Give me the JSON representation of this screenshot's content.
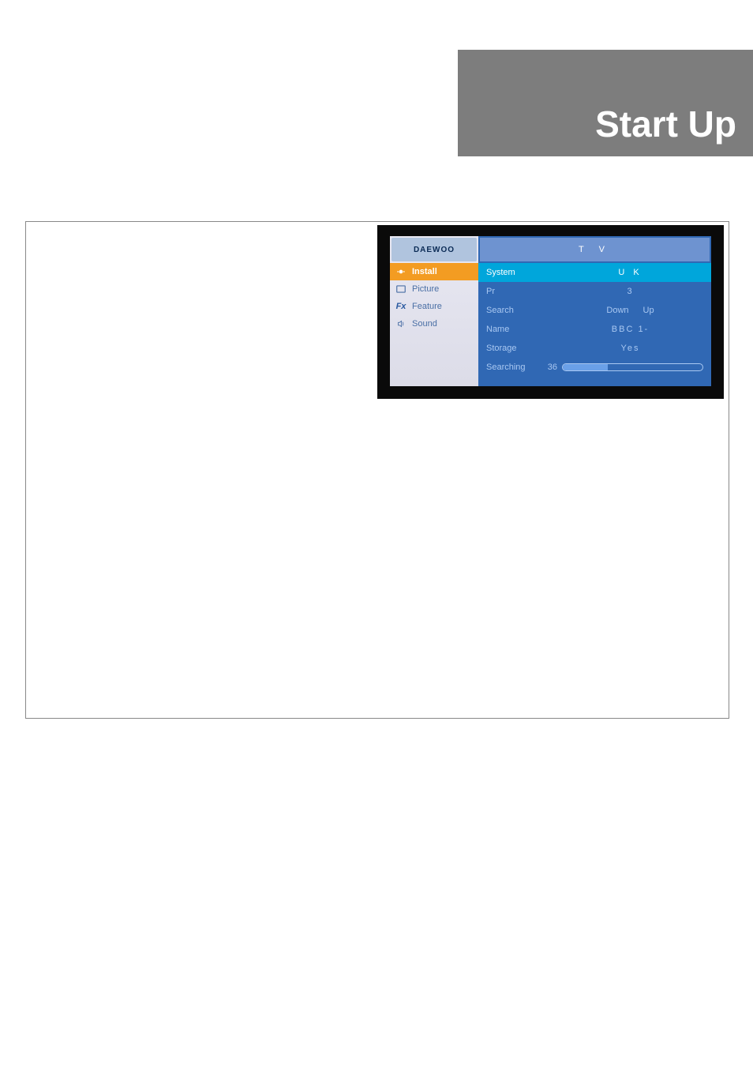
{
  "header": {
    "title": "Start Up"
  },
  "tv": {
    "brand": "DAEWOO",
    "sidebar": [
      {
        "label": "Install",
        "active": true,
        "icon": "install-icon"
      },
      {
        "label": "Picture",
        "active": false,
        "icon": "picture-icon"
      },
      {
        "label": "Feature",
        "active": false,
        "icon": "feature-icon"
      },
      {
        "label": "Sound",
        "active": false,
        "icon": "sound-icon"
      }
    ],
    "header_label": "T V",
    "rows": {
      "system_label": "System",
      "system_value": "U K",
      "pr_label": "Pr",
      "pr_value": "3",
      "search_label": "Search",
      "search_down": "Down",
      "search_up": "Up",
      "name_label": "Name",
      "name_value": "BBC 1-",
      "storage_label": "Storage",
      "storage_value": "Yes",
      "searching_label": "Searching",
      "searching_value": "36"
    }
  }
}
